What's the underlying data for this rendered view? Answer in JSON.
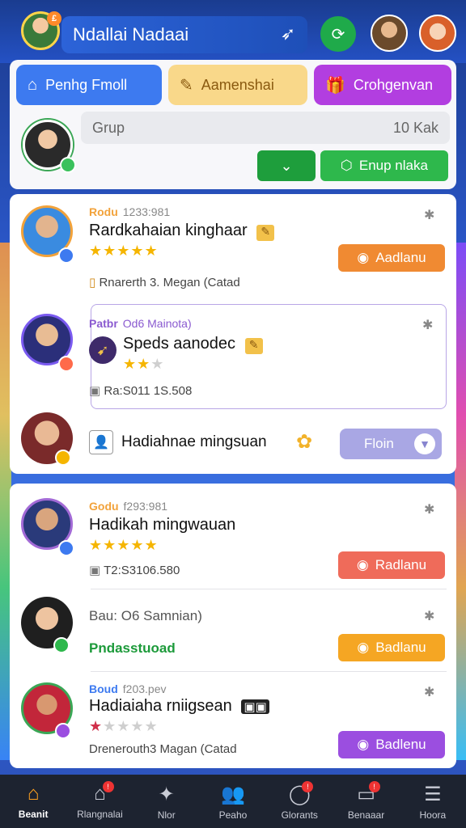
{
  "header": {
    "title": "Ndallai Nadaai",
    "notification_count": "£"
  },
  "tabs": [
    {
      "label": "Penhg Fmoll",
      "icon": "home-icon"
    },
    {
      "label": "Aamenshai",
      "icon": "pencil-icon"
    },
    {
      "label": "Crohgenvan",
      "icon": "gift-icon"
    }
  ],
  "group": {
    "field_label": "Grup",
    "field_value": "10 Kak",
    "button_label": "Enup nlaka"
  },
  "card1": {
    "entries": [
      {
        "tag": "Rodu",
        "number": "1233:981",
        "name": "Rardkahaian kinghaar",
        "rating": 5,
        "sub": "Rnarerth 3. Megan (Catad",
        "action": "Aadlanu",
        "action_color": "#f08a32"
      },
      {
        "tag": "Patbr",
        "number": "Od6 Mainota)",
        "name": "Speds aanodec",
        "rating": 2,
        "sub": "Ra:S011 1S.508"
      },
      {
        "name": "Hadiahnae mingsuan",
        "action": "Floin"
      }
    ]
  },
  "card2": {
    "entries": [
      {
        "tag": "Godu",
        "number": "f293:981",
        "name": "Hadikah mingwauan",
        "rating": 5,
        "sub": "T2:S3106.580",
        "action": "Radlanu",
        "action_color": "#ef6b5a"
      },
      {
        "tag": "Bau:",
        "number": "O6 Samnian)",
        "sub": "Pndasstuoad",
        "action": "Badlanu",
        "action_color": "#f5a623"
      },
      {
        "tag": "Boud",
        "number": "f203.pev",
        "name": "Hadiaiaha rniigsean",
        "rating": 1,
        "sub": "Drenerouth3 Magan (Catad",
        "action": "Badlenu",
        "action_color": "#9b4ee0"
      }
    ]
  },
  "nav": [
    {
      "label": "Beanit",
      "icon": "home-icon",
      "active": true
    },
    {
      "label": "Rlangnalai",
      "icon": "house-icon",
      "badge": "!"
    },
    {
      "label": "Nlor",
      "icon": "star-icon"
    },
    {
      "label": "Peaho",
      "icon": "people-icon"
    },
    {
      "label": "Glorants",
      "icon": "chat-icon",
      "badge": "!"
    },
    {
      "label": "Benaaar",
      "icon": "inbox-icon",
      "badge": "!"
    },
    {
      "label": "Hoora",
      "icon": "menu-icon"
    }
  ]
}
